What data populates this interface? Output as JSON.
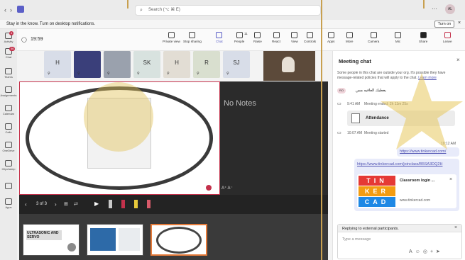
{
  "titlebar": {
    "search_placeholder": "Search (⌥ ⌘ E)",
    "user_initials": "AL"
  },
  "notification": {
    "text": "Stay in the know. Turn on desktop notifications.",
    "button": "Turn on"
  },
  "rail": {
    "items": [
      {
        "label": "Activity",
        "badge": "4"
      },
      {
        "label": "Chat",
        "badge": "46"
      },
      {
        "label": "Teams",
        "badge": ""
      },
      {
        "label": "Assignments",
        "badge": ""
      },
      {
        "label": "Calendar",
        "badge": ""
      },
      {
        "label": "Calls",
        "badge": ""
      },
      {
        "label": "OneDrive",
        "badge": ""
      },
      {
        "label": "Clipchamp",
        "badge": ""
      },
      {
        "label": "",
        "badge": ""
      },
      {
        "label": "Apps",
        "badge": ""
      }
    ]
  },
  "toolbar": {
    "timer": "19:59",
    "buttons": [
      {
        "label": "Private view",
        "icon": "eye-icon"
      },
      {
        "label": "Stop sharing",
        "icon": "stop-share-icon"
      },
      {
        "label": "Chat",
        "icon": "chat-icon",
        "active": true
      },
      {
        "label": "People",
        "icon": "people-icon",
        "count": "11"
      },
      {
        "label": "Raise",
        "icon": "hand-icon"
      },
      {
        "label": "React",
        "icon": "smile-icon"
      },
      {
        "label": "View",
        "icon": "grid-icon"
      },
      {
        "label": "Controls",
        "icon": "controls-icon"
      },
      {
        "label": "Apps",
        "icon": "plus-icon"
      },
      {
        "label": "More",
        "icon": "more-icon"
      },
      {
        "label": "Camera",
        "icon": "camera-icon"
      },
      {
        "label": "Mic",
        "icon": "mic-icon"
      },
      {
        "label": "Share",
        "icon": "share-icon"
      },
      {
        "label": "Leave",
        "icon": "phone-icon"
      }
    ]
  },
  "participants": [
    {
      "initials": "H"
    },
    {
      "initials": ""
    },
    {
      "initials": ""
    },
    {
      "initials": "SK"
    },
    {
      "initials": "H"
    },
    {
      "initials": "R"
    },
    {
      "initials": "SJ"
    }
  ],
  "stage": {
    "notes": "No Notes",
    "slide_counter": "3 of 3",
    "thumb1_title": "ULTRASONIC AND SERVO",
    "font_controls": "A⁺ A⁻"
  },
  "chat": {
    "title": "Meeting chat",
    "external_notice": "Some people in this chat are outside your org. It's possible they have message-related policies that will apply to the chat.",
    "learn_more": "Learn more",
    "rtl_name": "يعطيك العافيه مس",
    "sender_initials": "RO",
    "event1_time": "9:41 AM",
    "event1_text": "Meeting ended: 2h 11m 25s",
    "attendance_label": "Attendance",
    "event2_time": "10:07 AM",
    "event2_text": "Meeting started",
    "msg_time": "10:12 AM",
    "msg_link1": "https://www.tinkercad.com/",
    "msg_link2": "https://www.tinkercad.com/joinclass/B5SA3DQ2H",
    "card_title": "Classroom login ...",
    "card_domain": "www.tinkercad.com",
    "tinkercad_letters": [
      "TIN",
      "KER",
      "CAD"
    ],
    "reply_notice": "Replying to external participants.",
    "input_placeholder": "Type a message"
  }
}
